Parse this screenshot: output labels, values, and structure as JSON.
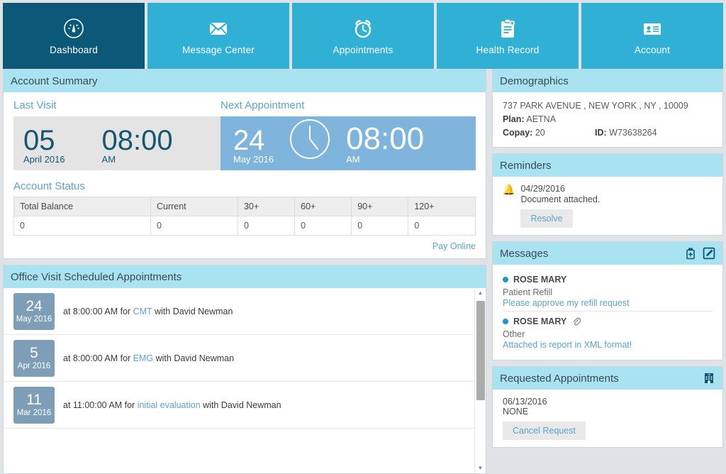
{
  "nav": {
    "items": [
      {
        "label": "Dashboard",
        "icon": "gauge-icon",
        "active": true
      },
      {
        "label": "Message Center",
        "icon": "envelope-icon",
        "active": false
      },
      {
        "label": "Appointments",
        "icon": "alarm-clock-icon",
        "active": false
      },
      {
        "label": "Health Record",
        "icon": "clipboard-icon",
        "active": false
      },
      {
        "label": "Account",
        "icon": "id-card-icon",
        "active": false
      }
    ]
  },
  "account_summary": {
    "title": "Account Summary",
    "last_visit": {
      "label": "Last Visit",
      "day": "05",
      "month_year": "April  2016",
      "time": "08:00",
      "meridiem": "AM"
    },
    "next_appointment": {
      "label": "Next Appointment",
      "day": "24",
      "month_year": "May  2016",
      "time": "08:00",
      "meridiem": "AM",
      "clock_icon": "clock-icon"
    },
    "account_status": {
      "label": "Account Status",
      "columns": [
        "Total Balance",
        "Current",
        "30+",
        "60+",
        "90+",
        "120+"
      ],
      "rows": [
        [
          "0",
          "0",
          "0",
          "0",
          "0",
          "0"
        ]
      ]
    },
    "pay_online": "Pay Online"
  },
  "office_visits": {
    "title": "Office Visit Scheduled Appointments",
    "rows": [
      {
        "day": "24",
        "month_year": "May 2016",
        "pre": "at 8:00:00 AM  for ",
        "reason": "CMT",
        "post": "  with David Newman"
      },
      {
        "day": "5",
        "month_year": "Apr 2016",
        "pre": "at 8:00:00 AM  for ",
        "reason": "EMG",
        "post": "  with David Newman"
      },
      {
        "day": "11",
        "month_year": "Mar 2016",
        "pre": "at 11:00:00 AM  for ",
        "reason": "initial evaluation",
        "post": "  with David Newman"
      }
    ]
  },
  "demographics": {
    "title": "Demographics",
    "address": "737 PARK AVENUE , NEW YORK , NY , 10009",
    "plan_label": "Plan:",
    "plan_value": "AETNA",
    "copay_label": "Copay:",
    "copay_value": "20",
    "id_label": "ID:",
    "id_value": "W73638264"
  },
  "reminders": {
    "title": "Reminders",
    "items": [
      {
        "date": "04/29/2016",
        "text": "Document attached.",
        "action": "Resolve",
        "icon": "bell-icon"
      }
    ]
  },
  "messages": {
    "title": "Messages",
    "icons": [
      "medication-bottle-icon",
      "compose-icon"
    ],
    "items": [
      {
        "from": "ROSE MARY",
        "subject": "Patient Refill",
        "body": "Please approve my refill request",
        "attachment": false
      },
      {
        "from": "ROSE MARY",
        "subject": "Other",
        "body": "Attached is report in XML format!",
        "attachment": true,
        "attachment_icon": "paperclip-icon"
      }
    ]
  },
  "requested_appointments": {
    "title": "Requested Appointments",
    "icon": "hospital-icon",
    "date": "06/13/2016",
    "status": "NONE",
    "action": "Cancel Request"
  },
  "colors": {
    "nav_active": "#0C5878",
    "nav_inactive": "#31B0D5",
    "panel_header": "#A9E3F2",
    "accent_link": "#5BA3D0",
    "next_appt_bg": "#7FB4DC",
    "date_badge": "#7E9EB8",
    "bell": "#F0922B",
    "page_bg": "#DFE3E6"
  }
}
